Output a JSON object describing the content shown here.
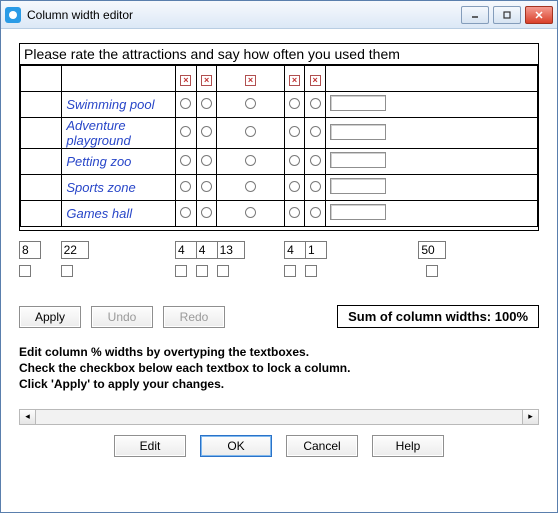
{
  "window": {
    "title": "Column width editor"
  },
  "grid": {
    "heading": "Please rate the attractions and say how often you used them",
    "rows": [
      "Swimming pool",
      "Adventure playground",
      "Petting zoo",
      "Sports zone",
      "Games hall"
    ]
  },
  "widths": {
    "values": [
      "8",
      "22",
      "4",
      "4",
      "13",
      "4",
      "1",
      "50"
    ]
  },
  "buttons": {
    "apply": "Apply",
    "undo": "Undo",
    "redo": "Redo"
  },
  "sum_prefix": "Sum of column widths: ",
  "sum_value": "100%",
  "help": {
    "l1": "Edit column % widths by overtyping the textboxes.",
    "l2": "Check the checkbox below each textbox to lock a column.",
    "l3": "Click 'Apply' to apply your changes."
  },
  "footer": {
    "edit": "Edit",
    "ok": "OK",
    "cancel": "Cancel",
    "help": "Help"
  }
}
